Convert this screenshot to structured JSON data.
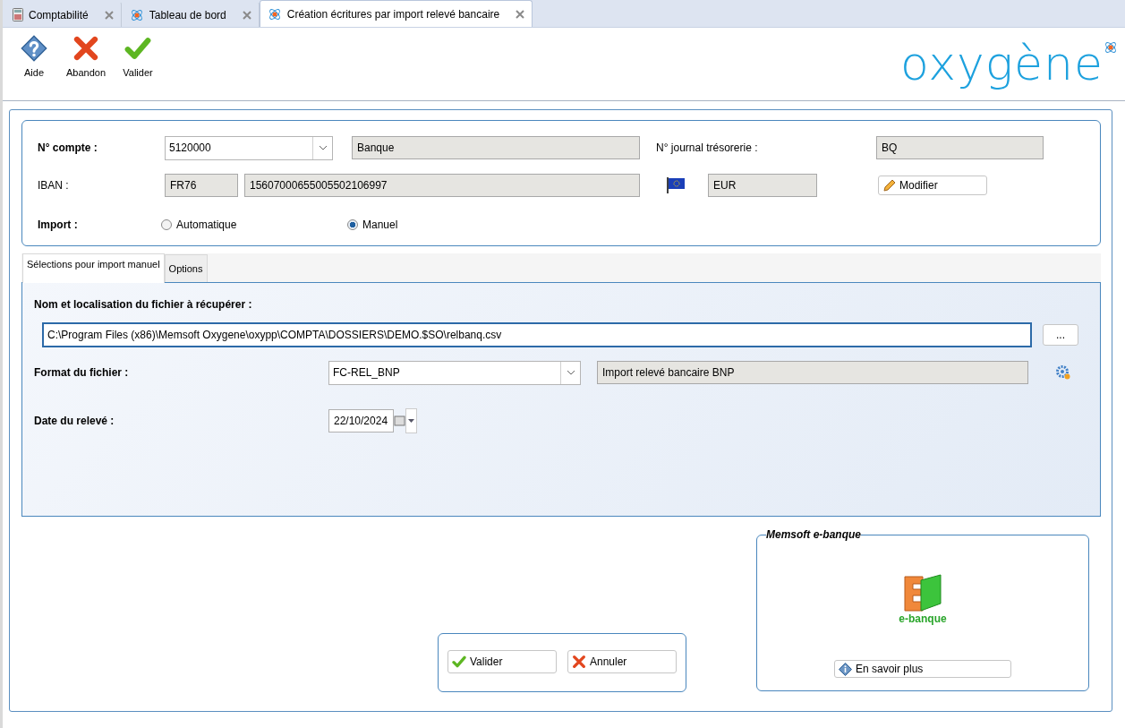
{
  "tabs": [
    {
      "label": "Comptabilité",
      "kind": "calculator",
      "selected": false
    },
    {
      "label": "Tableau de bord",
      "kind": "atom",
      "selected": false
    },
    {
      "label": "Création écritures par import relevé bancaire",
      "kind": "atom",
      "selected": true
    }
  ],
  "toolbar": [
    {
      "label": "Aide",
      "kind": "help"
    },
    {
      "label": "Abandon",
      "kind": "cancel"
    },
    {
      "label": "Valider",
      "kind": "validate"
    }
  ],
  "logo": {
    "text": "oxygène"
  },
  "account": {
    "label": "N° compte :",
    "value": "5120000",
    "name": "Banque",
    "journal_label": "N° journal trésorerie :",
    "journal": "BQ"
  },
  "iban": {
    "label": "IBAN :",
    "prefix": "FR76",
    "number": "15607000655005502106997",
    "currency": "EUR",
    "edit_button": "Modifier"
  },
  "import": {
    "label": "Import :",
    "options": [
      {
        "label": "Automatique",
        "selected": false
      },
      {
        "label": "Manuel",
        "selected": true
      }
    ]
  },
  "subtabs": [
    {
      "label": "Sélections pour import manuel",
      "selected": true
    },
    {
      "label": "Options",
      "selected": false
    }
  ],
  "file": {
    "label": "Nom et localisation du fichier à récupérer :",
    "value": "C:\\Program Files (x86)\\Memsoft Oxygene\\oxypp\\COMPTA\\DOSSIERS\\DEMO.$SO\\relbanq.csv",
    "browse_button": "..."
  },
  "format": {
    "label": "Format du fichier :",
    "value": "FC-REL_BNP",
    "description": "Import relevé bancaire BNP"
  },
  "date": {
    "label": "Date du relevé :",
    "value": "22/10/2024"
  },
  "actions": [
    {
      "label": "Valider",
      "kind": "validate"
    },
    {
      "label": "Annuler",
      "kind": "cancel"
    }
  ],
  "ebanque": {
    "title": "Memsoft e-banque",
    "logo_text": "e-banque",
    "button": "En savoir plus"
  }
}
